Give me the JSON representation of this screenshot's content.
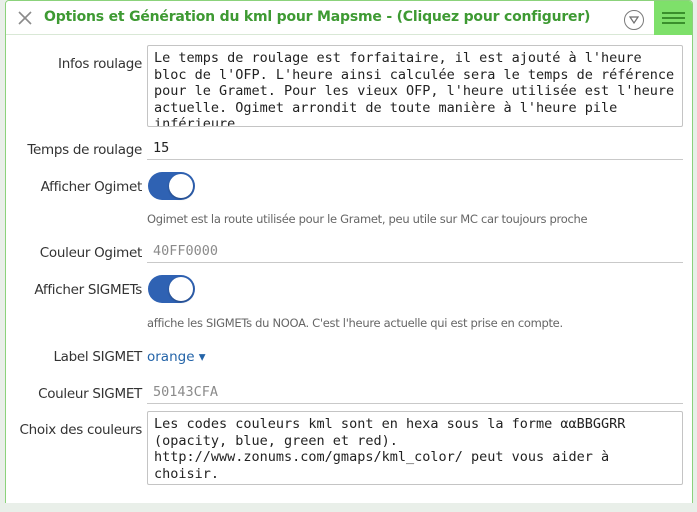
{
  "header": {
    "title": "Options et Génération du kml pour Mapsme - (Cliquez pour configurer)",
    "close_icon": "close-icon",
    "chevron_icon": "chevron-down-icon",
    "menu_icon": "hamburger-menu-icon"
  },
  "colors": {
    "title": "#3e9a33",
    "menu_bg": "#7ee06a",
    "toggle_on": "#2f62b3",
    "link": "#2464a8",
    "border": "#8bd27b"
  },
  "form": {
    "infos_roulage": {
      "label": "Infos roulage",
      "value": "Le temps de roulage est forfaitaire, il est ajouté à l'heure bloc de l'OFP. L'heure ainsi calculée sera le temps de référence pour le Gramet. Pour les vieux OFP, l'heure utilisée est l'heure actuelle. Ogimet arrondit de toute manière à l'heure pile inférieure."
    },
    "temps_roulage": {
      "label": "Temps de roulage",
      "value": "15"
    },
    "afficher_ogimet": {
      "label": "Afficher Ogimet",
      "state": "on",
      "help": "Ogimet est la route utilisée pour le Gramet, peu utile sur MC car toujours proche"
    },
    "couleur_ogimet": {
      "label": "Couleur Ogimet",
      "placeholder": "40FF0000"
    },
    "afficher_sigmets": {
      "label": "Afficher SIGMETs",
      "state": "on",
      "help": "affiche les SIGMETs du NOOA. C'est l'heure actuelle qui est prise en compte."
    },
    "label_sigmet": {
      "label": "Label SIGMET",
      "value": "orange ▾"
    },
    "couleur_sigmet": {
      "label": "Couleur SIGMET",
      "placeholder": "50143CFA"
    },
    "choix_couleurs": {
      "label": "Choix des couleurs",
      "value": "Les codes couleurs kml sont en hexa sous la forme ααBBGGRR (opacity, blue, green et red).\nhttp://www.zonums.com/gmaps/kml_color/ peut vous aider à choisir."
    }
  }
}
